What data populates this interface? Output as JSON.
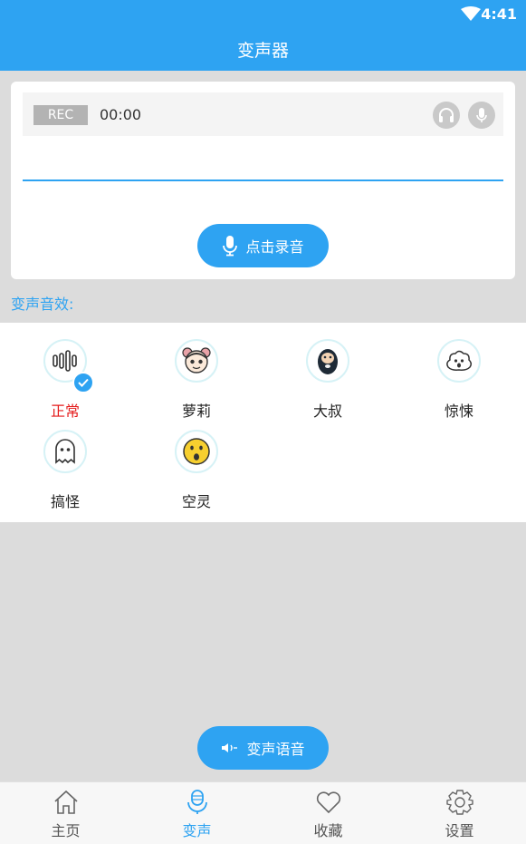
{
  "status_bar": {
    "time": "4:41"
  },
  "app_bar": {
    "title": "变声器"
  },
  "recorder": {
    "badge": "REC",
    "time": "00:00",
    "record_button": "点击录音"
  },
  "effects_section": {
    "label": "变声音效:",
    "items": [
      {
        "label": "正常",
        "icon": "waveform-icon",
        "selected": true
      },
      {
        "label": "萝莉",
        "icon": "girl-face-icon",
        "selected": false
      },
      {
        "label": "大叔",
        "icon": "bearded-man-icon",
        "selected": false
      },
      {
        "label": "惊悚",
        "icon": "scared-ghost-icon",
        "selected": false
      },
      {
        "label": "搞怪",
        "icon": "ghost-icon",
        "selected": false
      },
      {
        "label": "空灵",
        "icon": "surprised-face-icon",
        "selected": false
      }
    ]
  },
  "voice_button": "变声语音",
  "bottom_nav": [
    {
      "label": "主页",
      "icon": "home-icon",
      "active": false
    },
    {
      "label": "变声",
      "icon": "microphone-icon",
      "active": true
    },
    {
      "label": "收藏",
      "icon": "heart-icon",
      "active": false
    },
    {
      "label": "设置",
      "icon": "gear-icon",
      "active": false
    }
  ],
  "colors": {
    "primary": "#2ea3f2",
    "selected_text": "#e41b1b",
    "background": "#dcdcdc"
  }
}
